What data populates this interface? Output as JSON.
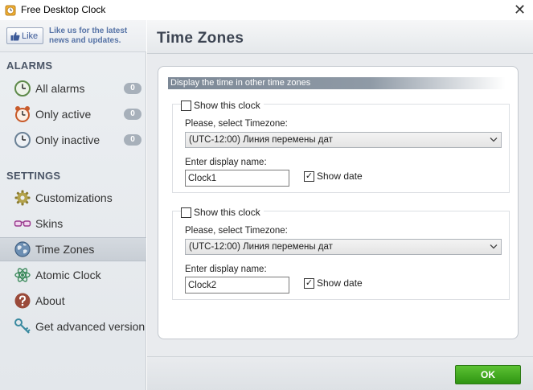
{
  "window": {
    "title": "Free Desktop Clock",
    "close_glyph": "✕"
  },
  "like": {
    "button_label": "Like",
    "text": "Like us for the latest news and updates."
  },
  "sidebar": {
    "alarms_heading": "ALARMS",
    "alarms": [
      {
        "label": "All alarms",
        "count": "0",
        "icon": "clock-icon"
      },
      {
        "label": "Only active",
        "count": "0",
        "icon": "alarm-clock-icon"
      },
      {
        "label": "Only inactive",
        "count": "0",
        "icon": "clock-inactive-icon"
      }
    ],
    "settings_heading": "SETTINGS",
    "settings": [
      {
        "label": "Customizations",
        "icon": "gear-icon"
      },
      {
        "label": "Skins",
        "icon": "glasses-icon"
      },
      {
        "label": "Time Zones",
        "icon": "globe-icon",
        "selected": true
      },
      {
        "label": "Atomic Clock",
        "icon": "atom-icon"
      },
      {
        "label": "About",
        "icon": "question-icon"
      },
      {
        "label": "Get advanced version",
        "icon": "key-icon"
      }
    ]
  },
  "main": {
    "title": "Time Zones",
    "caption": "Display the time in other time zones",
    "clocks": [
      {
        "show_label": "Show this clock",
        "show_checked": false,
        "timezone_label": "Please, select Timezone:",
        "timezone_value": "(UTC-12:00) Линия перемены дат",
        "name_label": "Enter display  name:",
        "name_value": "Clock1",
        "show_date_label": "Show date",
        "show_date_checked": true
      },
      {
        "show_label": "Show this clock",
        "show_checked": false,
        "timezone_label": "Please, select Timezone:",
        "timezone_value": "(UTC-12:00) Линия перемены дат",
        "name_label": "Enter display  name:",
        "name_value": "Clock2",
        "show_date_label": "Show date",
        "show_date_checked": true
      }
    ]
  },
  "footer": {
    "ok_label": "OK"
  },
  "check_glyph": "✓",
  "colors": {
    "ok_green": "#3aa11a",
    "like_blue": "#5673a6",
    "selected_bg": "#cfd5dc"
  }
}
